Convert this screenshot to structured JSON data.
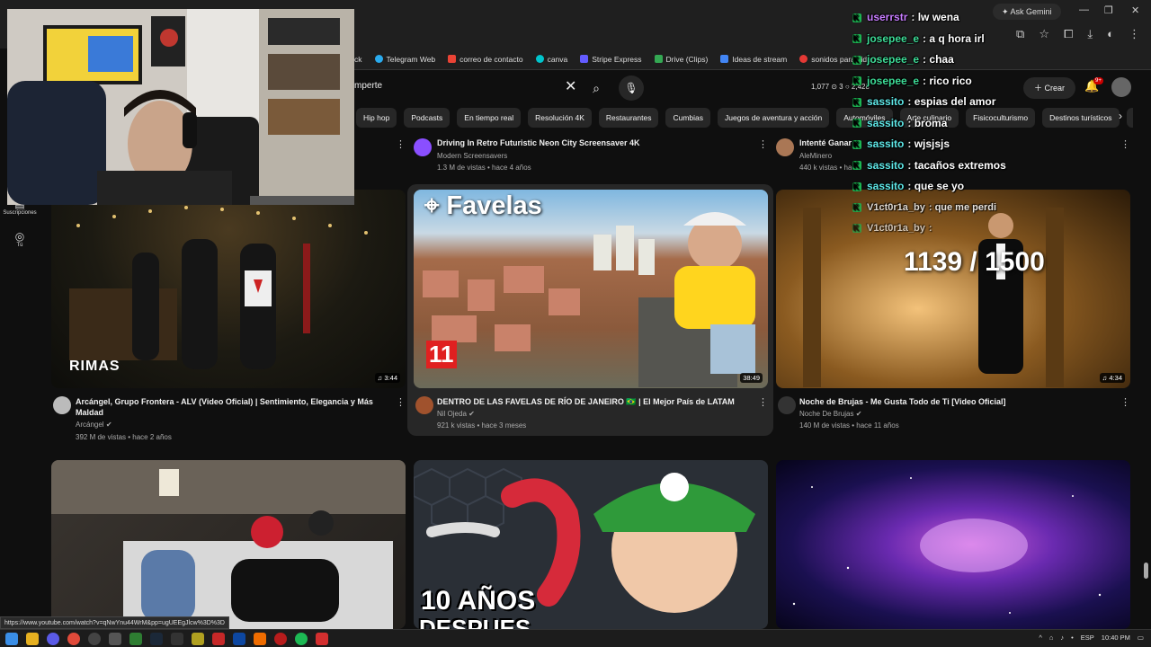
{
  "browser": {
    "gemini_label": "Ask Gemini",
    "bookmarks": [
      {
        "label": "Telegram Web",
        "color": "#2aabee"
      },
      {
        "label": "correo de contacto",
        "color": "#ea4335"
      },
      {
        "label": "canva",
        "color": "#00c4cc"
      },
      {
        "label": "Stripe Express",
        "color": "#635bff"
      },
      {
        "label": "Drive (Clips)",
        "color": "#34a853"
      },
      {
        "label": "Ideas de stream",
        "color": "#4285f4"
      },
      {
        "label": "sonidos para videos",
        "color": "#e53935"
      }
    ],
    "bookmark_lead": "ck"
  },
  "header": {
    "search_value": "mperte",
    "stats": "1,077 ⊙ 3 ○ 2,428",
    "create_label": "Crear",
    "notif_count": "9+"
  },
  "chips": [
    "Hip hop",
    "Podcasts",
    "En tiempo real",
    "Resolución 4K",
    "Restaurantes",
    "Cumbias",
    "Juegos de aventura y acción",
    "Automóviles",
    "Arte culinario",
    "Fisicoculturismo",
    "Destinos turísticos",
    "Su"
  ],
  "sidebar": [
    {
      "label": "Suscripciones",
      "icon": "subscriptions-icon"
    },
    {
      "label": "Tú",
      "icon": "user-icon"
    }
  ],
  "top_row": [
    {
      "title": "Driving In Retro Futuristic Neon City Screensaver 4K",
      "channel": "Modern Screensavers",
      "meta": "1.3 M de vistas • hace 4 años"
    },
    {
      "title": "Intenté Ganar",
      "channel": "AleMinero",
      "meta": "440 k vistas • ha"
    }
  ],
  "videos": [
    {
      "title": "Arcángel, Grupo Frontera - ALV (Video Oficial) | Sentimiento, Elegancia y Más Maldad",
      "channel": "Arcángel",
      "meta": "392 M de vistas • hace 2 años",
      "duration": "3:44",
      "overlay": "RIMAS"
    },
    {
      "title": "DENTRO DE LAS FAVELAS DE RÍO DE JANEIRO 🇧🇷 | El Mejor País de LATAM",
      "channel": "Nil Ojeda",
      "meta": "921 k vistas • hace 3 meses",
      "duration": "38:49",
      "overlay": "Favelas",
      "badge": "11"
    },
    {
      "title": "Noche de Brujas - Me Gusta Todo de Ti [Video Oficial]",
      "channel": "Noche De Brujas",
      "meta": "140 M de vistas • hace 11 años",
      "duration": "4:34",
      "overlay": "1139 / 1500"
    }
  ],
  "bottom_overlay": "10 AÑOS",
  "bottom_overlay2": "DESPUES",
  "chat": [
    {
      "user": "userrstr",
      "msg": "lw wena",
      "color": "#c77dff"
    },
    {
      "user": "josepee_e",
      "msg": "a q hora irl",
      "color": "#3ddc97"
    },
    {
      "user": "josepee_e",
      "msg": "chaa",
      "color": "#3ddc97"
    },
    {
      "user": "josepee_e",
      "msg": "rico rico",
      "color": "#3ddc97"
    },
    {
      "user": "sassito",
      "msg": "espias del amor",
      "color": "#5ee7e7"
    },
    {
      "user": "sassito",
      "msg": "broma",
      "color": "#5ee7e7"
    },
    {
      "user": "sassito",
      "msg": "wjsjsjs",
      "color": "#5ee7e7"
    },
    {
      "user": "sassito",
      "msg": "tacaños extremos",
      "color": "#5ee7e7"
    },
    {
      "user": "sassito",
      "msg": "que se yo",
      "color": "#5ee7e7"
    },
    {
      "user": "V1ct0r1a_by",
      "msg": "que me perdi",
      "color": "#f5f5f5"
    },
    {
      "user": "V1ct0r1a_by",
      "msg": "",
      "color": "#f5f5f5"
    }
  ],
  "status_url": "https://www.youtube.com/watch?v=qNwYnu44WrM&pp=ugUEEgJlcw%3D%3D",
  "tray": {
    "lang": "ESP",
    "time": "10:40 PM"
  }
}
